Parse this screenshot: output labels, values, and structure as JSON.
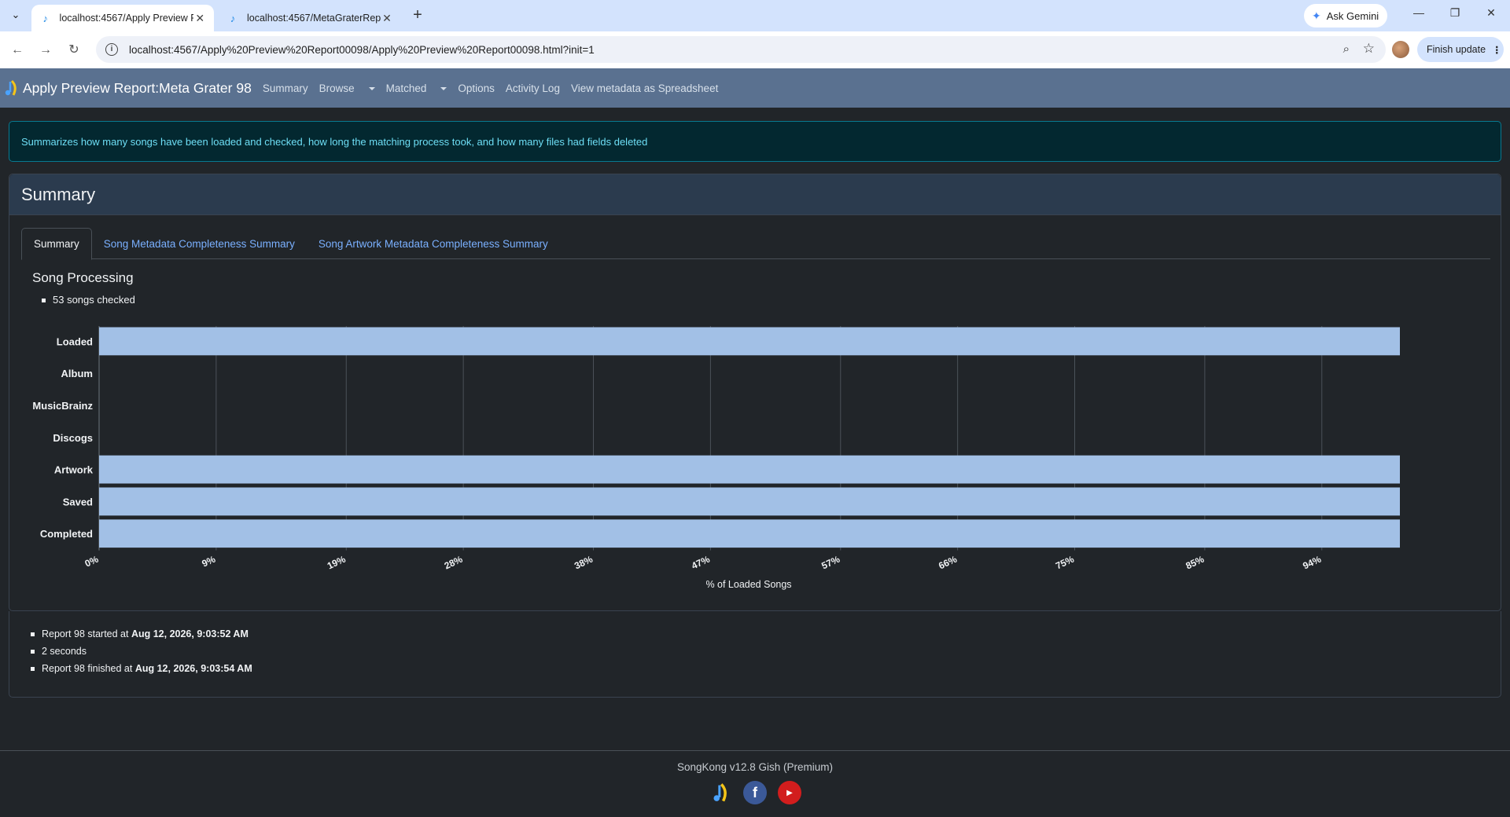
{
  "browser": {
    "tabs": [
      {
        "title": "localhost:4567/Apply Preview R",
        "active": true
      },
      {
        "title": "localhost:4567/MetaGraterRep",
        "active": false
      }
    ],
    "ask_gemini": "Ask Gemini",
    "url": "localhost:4567/Apply%20Preview%20Report00098/Apply%20Preview%20Report00098.html?init=1",
    "finish_update": "Finish update"
  },
  "app": {
    "brand": "Apply Preview Report:Meta Grater 98",
    "nav": {
      "summary": "Summary",
      "browse": "Browse",
      "matched": "Matched",
      "options": "Options",
      "activity_log": "Activity Log",
      "view_spreadsheet": "View metadata as Spreadsheet"
    }
  },
  "alert": "Summarizes how many songs have been loaded and checked, how long the matching process took, and how many files had fields deleted",
  "card": {
    "title": "Summary",
    "tabs": [
      "Summary",
      "Song Metadata Completeness Summary",
      "Song Artwork Metadata Completeness Summary"
    ],
    "section_title": "Song Processing",
    "section_items": [
      "53 songs checked"
    ]
  },
  "chart_data": {
    "type": "bar",
    "orientation": "horizontal",
    "categories": [
      "Loaded",
      "Album",
      "MusicBrainz",
      "Discogs",
      "Artwork",
      "Saved",
      "Completed"
    ],
    "values": [
      100,
      0,
      0,
      0,
      100,
      100,
      100
    ],
    "xlabel": "% of Loaded Songs",
    "ticks": [
      "0%",
      "9%",
      "19%",
      "28%",
      "38%",
      "47%",
      "57%",
      "66%",
      "75%",
      "85%",
      "94%"
    ],
    "xlim": [
      0,
      100
    ],
    "bar_color": "#a2c0e6",
    "grid": true
  },
  "report": {
    "started_prefix": "Report 98 started at ",
    "started_at": "Aug 12, 2026, 9:03:52 AM",
    "duration": "2 seconds",
    "finished_prefix": "Report 98 finished at ",
    "finished_at": "Aug 12, 2026, 9:03:54 AM"
  },
  "footer": {
    "version": "SongKong v12.8 Gish (Premium)",
    "icons": [
      "songkong-icon",
      "facebook-icon",
      "youtube-icon"
    ]
  }
}
